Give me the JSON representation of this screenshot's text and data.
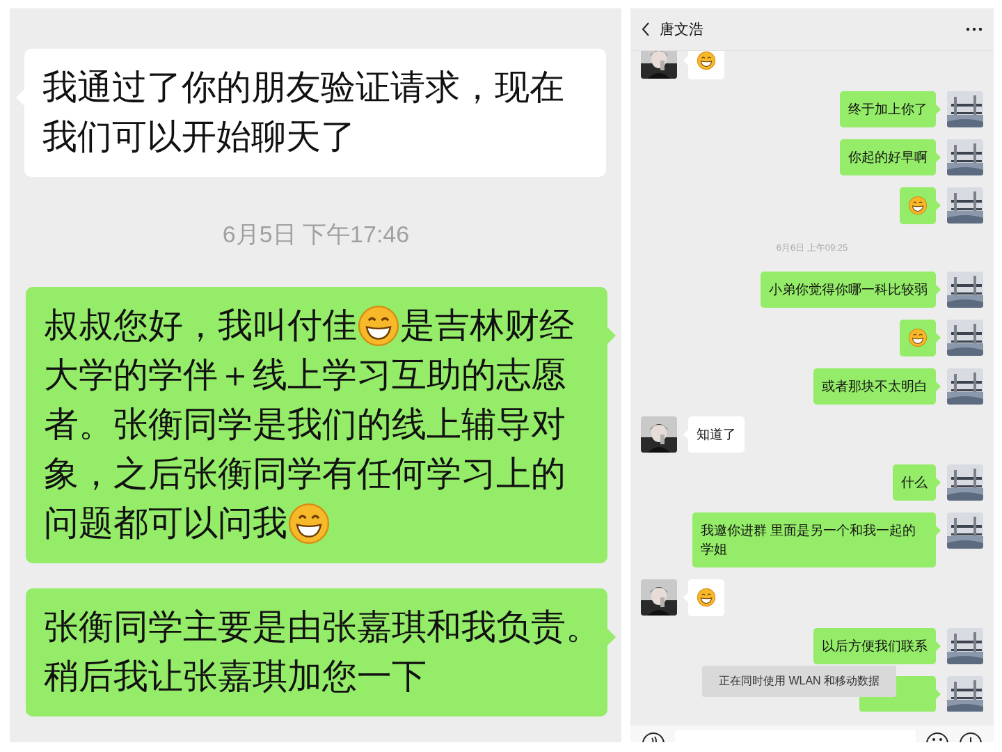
{
  "left_panel": {
    "items": [
      {
        "kind": "message",
        "outgoing": false,
        "lines": [
          [
            {
              "kind": "text",
              "text": "我通过了你的朋友验证请求，现在"
            }
          ],
          [
            {
              "kind": "text",
              "text": "我们可以开始聊天了"
            }
          ]
        ]
      },
      {
        "kind": "time",
        "text": "6月5日 下午17:46"
      },
      {
        "kind": "message",
        "outgoing": true,
        "lines": [
          [
            {
              "kind": "text",
              "text": "叔叔您好，我叫付佳"
            },
            {
              "kind": "emoji"
            },
            {
              "kind": "text",
              "text": "是吉林财经"
            }
          ],
          [
            {
              "kind": "text",
              "text": "大学的学伴＋线上学习互助的志愿"
            }
          ],
          [
            {
              "kind": "text",
              "text": "者。张衡同学是我们的线上辅导对"
            }
          ],
          [
            {
              "kind": "text",
              "text": "象，之后张衡同学有任何学习上的"
            }
          ],
          [
            {
              "kind": "text",
              "text": "问题都可以问我"
            },
            {
              "kind": "emoji"
            }
          ]
        ]
      },
      {
        "kind": "message",
        "outgoing": true,
        "lines": [
          [
            {
              "kind": "text",
              "text": "张衡同学主要是由张嘉琪和我负责。"
            }
          ],
          [
            {
              "kind": "text",
              "text": "稍后我让张嘉琪加您一下"
            }
          ]
        ]
      }
    ]
  },
  "chat": {
    "title": "唐文浩",
    "items": [
      {
        "kind": "message",
        "outgoing": false,
        "parts": [
          {
            "kind": "emoji"
          }
        ]
      },
      {
        "kind": "message",
        "outgoing": true,
        "parts": [
          {
            "kind": "text",
            "text": "终于加上你了"
          }
        ]
      },
      {
        "kind": "message",
        "outgoing": true,
        "parts": [
          {
            "kind": "text",
            "text": "你起的好早啊"
          }
        ]
      },
      {
        "kind": "message",
        "outgoing": true,
        "parts": [
          {
            "kind": "emoji"
          }
        ]
      },
      {
        "kind": "time",
        "text": "6月6日 上午09:25"
      },
      {
        "kind": "message",
        "outgoing": true,
        "parts": [
          {
            "kind": "text",
            "text": "小弟你觉得你哪一科比较弱"
          }
        ]
      },
      {
        "kind": "message",
        "outgoing": true,
        "parts": [
          {
            "kind": "emoji"
          }
        ]
      },
      {
        "kind": "message",
        "outgoing": true,
        "parts": [
          {
            "kind": "text",
            "text": "或者那块不太明白"
          }
        ]
      },
      {
        "kind": "message",
        "outgoing": false,
        "parts": [
          {
            "kind": "text",
            "text": "知道了"
          }
        ]
      },
      {
        "kind": "message",
        "outgoing": true,
        "parts": [
          {
            "kind": "text",
            "text": "什么"
          }
        ]
      },
      {
        "kind": "message",
        "outgoing": true,
        "parts": [
          {
            "kind": "text",
            "text": "我邀你进群 里面是另一个和我一起的学姐"
          }
        ]
      },
      {
        "kind": "message",
        "outgoing": false,
        "parts": [
          {
            "kind": "emoji"
          }
        ]
      },
      {
        "kind": "message",
        "outgoing": true,
        "parts": [
          {
            "kind": "text",
            "text": "以后方便我们联系"
          }
        ]
      },
      {
        "kind": "covered",
        "outgoing": true
      }
    ],
    "toast": "正在同时使用 WLAN 和移动数据"
  }
}
